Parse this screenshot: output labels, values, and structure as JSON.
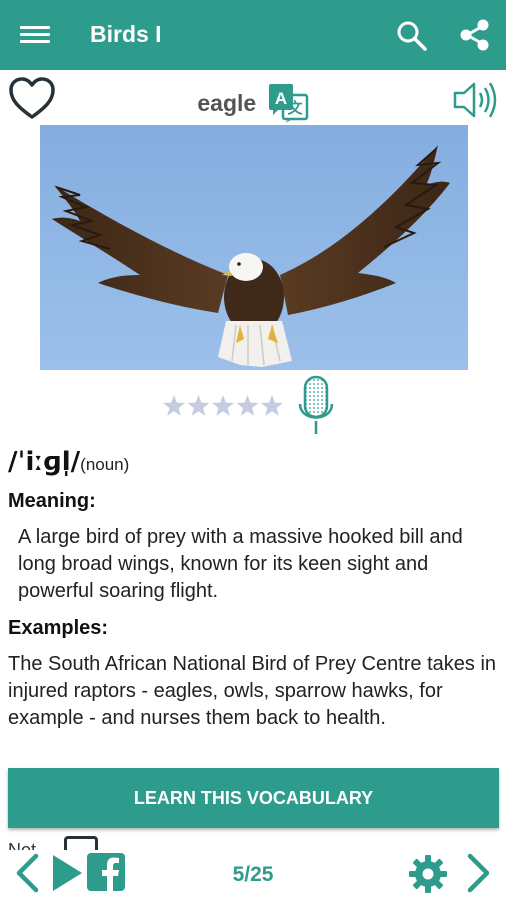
{
  "app_bar": {
    "title": "Birds I",
    "icons": [
      "menu-icon",
      "search-icon",
      "share-icon"
    ]
  },
  "card": {
    "word": "eagle",
    "image_alt": "eagle",
    "rating": {
      "value": 0,
      "max": 5
    },
    "pronunciation": "/ˈiːɡl̩/",
    "part_of_speech": "(noun)",
    "meaning_label": "Meaning:",
    "meaning": "A large bird of prey with a massive hooked bill and long broad wings, known for its keen sight and powerful soaring flight.",
    "examples_label": "Examples:",
    "examples": "The South African National Bird of Prey Centre takes in injured raptors - eagles, owls, sparrow hawks, for example - and nurses them back to health."
  },
  "learn_button": "LEARN THIS VOCABULARY",
  "peek_text": "Not",
  "bottom_bar": {
    "page": "5/25"
  },
  "colors": {
    "primary": "#2e9c8c",
    "sky": "#8ab4e4",
    "star_empty": "#c5cbe0"
  }
}
